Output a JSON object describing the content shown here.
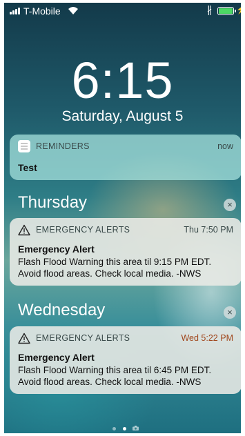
{
  "status_bar": {
    "carrier": "T-Mobile",
    "signal_bars": 4,
    "battery_color": "#4cd964",
    "icons": [
      "signal-icon",
      "wifi-icon",
      "bluetooth-icon",
      "battery-icon",
      "charging-icon"
    ]
  },
  "lock_screen": {
    "time": "6:15",
    "date": "Saturday, August 5"
  },
  "notifications": {
    "reminder": {
      "app": "REMINDERS",
      "when": "now",
      "title": "Test",
      "icon": "reminders-app-icon"
    },
    "sections": [
      {
        "label": "Thursday",
        "clear_glyph": "×",
        "alert": {
          "app": "EMERGENCY ALERTS",
          "when": "Thu 7:50 PM",
          "title": "Emergency Alert",
          "body": "Flash Flood Warning this area til 9:15 PM EDT. Avoid flood areas. Check local media. -NWS",
          "icon": "warning-triangle-icon"
        }
      },
      {
        "label": "Wednesday",
        "clear_glyph": "×",
        "alert": {
          "app": "EMERGENCY ALERTS",
          "when": "Wed 5:22 PM",
          "title": "Emergency Alert",
          "body": "Flash Flood Warning this area til 6:45 PM EDT. Avoid flood areas. Check local media. -NWS",
          "icon": "warning-triangle-icon"
        }
      }
    ]
  },
  "page_indicator": {
    "pages": 3,
    "active_index": 1,
    "last_is_camera": true
  }
}
